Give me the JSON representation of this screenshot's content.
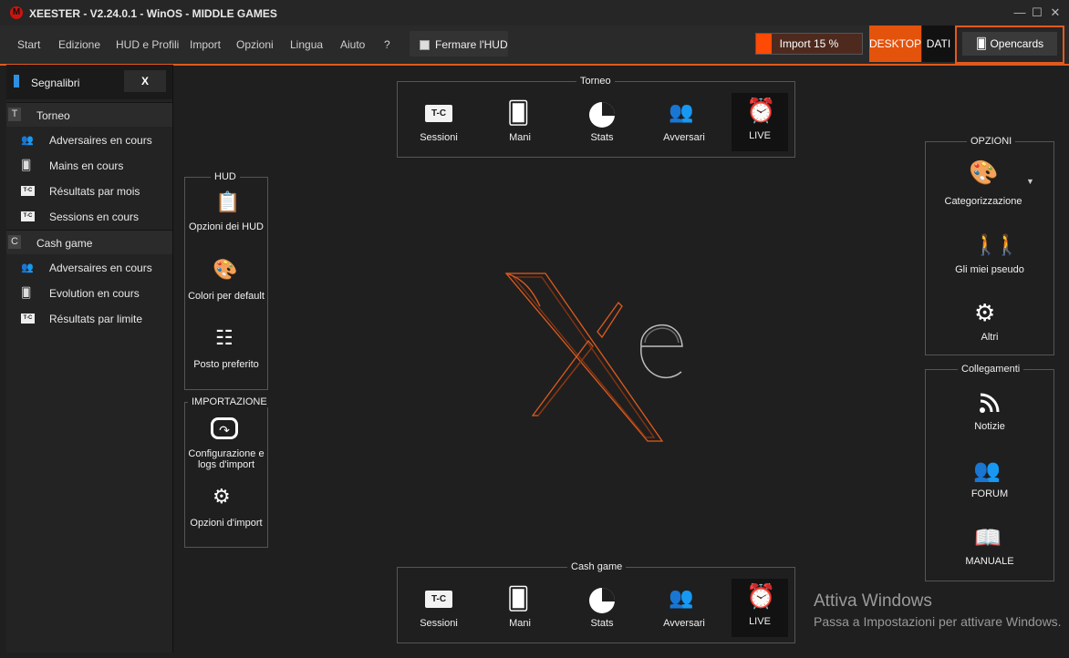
{
  "window": {
    "title": "XEESTER - V2.24.0.1 - WinOS - MIDDLE GAMES",
    "logo_letter": "M"
  },
  "menu": {
    "items": [
      "Start",
      "Edizione",
      "HUD e Profili",
      "Import",
      "Opzioni",
      "Lingua",
      "Aiuto",
      "?"
    ],
    "stop_hud": "Fermare l'HUD",
    "import_progress": {
      "label": "Import 15 %",
      "fraction": 0.15
    },
    "desktop": "DESKTOP",
    "dati": "DATI",
    "opencards": "Opencards"
  },
  "sidebar": {
    "bookmarks_label": "Segnalibri",
    "close_label": "X",
    "tournament": {
      "badge": "T",
      "label": "Torneo",
      "items": [
        "Adversaires en cours",
        "Mains en cours",
        "Résultats par mois",
        "Sessions en cours"
      ]
    },
    "cash": {
      "badge": "C",
      "label": "Cash game",
      "items": [
        "Adversaires en cours",
        "Evolution en cours",
        "Résultats par limite"
      ]
    }
  },
  "torneo": {
    "title": "Torneo",
    "tiles": [
      "Sessioni",
      "Mani",
      "Stats",
      "Avversari",
      "LIVE"
    ],
    "tc_text": "T-C"
  },
  "cash_game": {
    "title": "Cash game",
    "tiles": [
      "Sessioni",
      "Mani",
      "Stats",
      "Avversari",
      "LIVE"
    ],
    "tc_text": "T-C"
  },
  "hud": {
    "title": "HUD",
    "tiles": [
      "Opzioni dei HUD",
      "Colori per default",
      "Posto preferito"
    ]
  },
  "importazione": {
    "title": "IMPORTAZIONE",
    "tiles": [
      "Configurazione e logs d'import",
      "Opzioni d'import"
    ]
  },
  "opzioni": {
    "title": "OPZIONI",
    "tiles": [
      "Categorizzazione",
      "Gli miei pseudo",
      "Altri"
    ]
  },
  "collegamenti": {
    "title": "Collegamenti",
    "tiles": [
      "Notizie",
      "FORUM",
      "MANUALE"
    ]
  },
  "watermark": {
    "line1": "Attiva Windows",
    "line2": "Passa a Impostazioni per attivare Windows."
  },
  "colors": {
    "accent": "#e05a1e",
    "import_bar": "#ff4a06",
    "background": "#1f1f1f"
  }
}
